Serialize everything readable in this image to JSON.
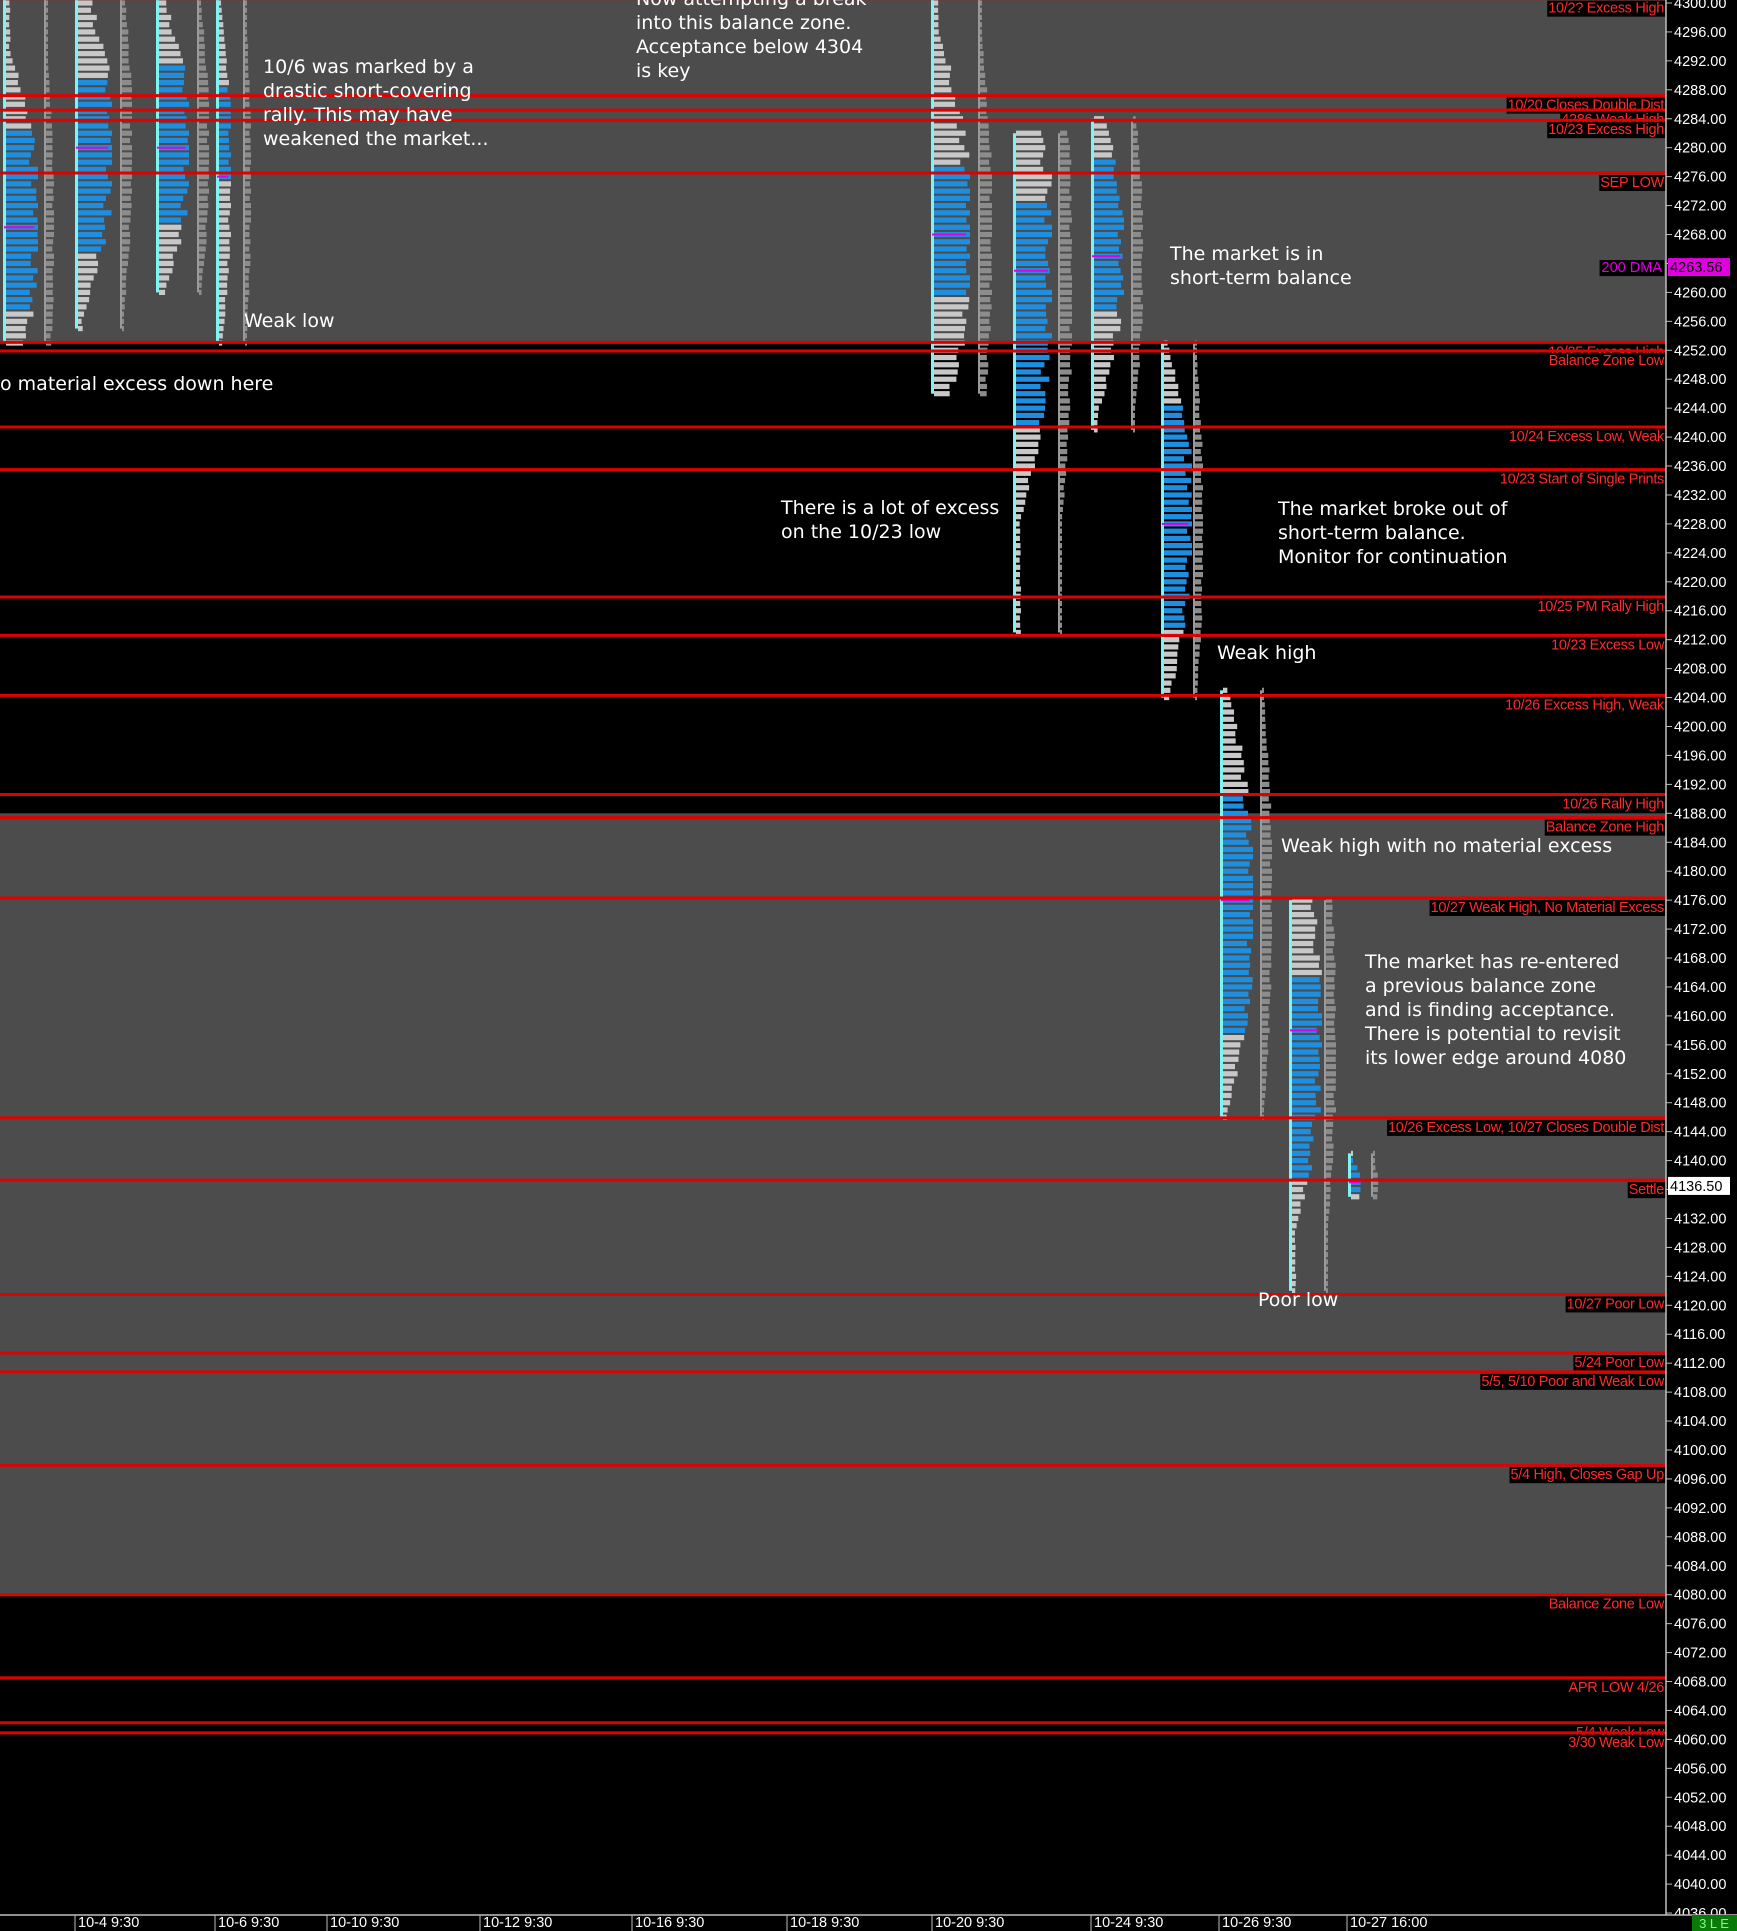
{
  "chart_data": {
    "type": "market_profile",
    "y_axis": {
      "min": 4035.5,
      "max": 4301.5,
      "tick_step": 4,
      "decimals": 2,
      "side": "right"
    },
    "x_axis_labels": [
      "10-4  9:30",
      "10-6  9:30",
      "10-10  9:30",
      "10-12  9:30",
      "10-16  9:30",
      "10-18  9:30",
      "10-20  9:30",
      "10-24  9:30",
      "10-26  9:30",
      "10-27  16:00"
    ],
    "corner_badge": "3 L E",
    "colors": {
      "background": "#000000",
      "zone_fill": "#4c4c4c",
      "level_line": "#e00000",
      "profile_blue": "#1e8fe0",
      "profile_gray": "#c8c8c8",
      "profile_cyan": "#7ff3f3",
      "poc": "#e000e0",
      "dma_tag": "#e000e0"
    },
    "balance_zones": [
      {
        "from": 4253,
        "to": 4301.5
      },
      {
        "from": 4080,
        "to": 4188
      }
    ],
    "levels": [
      {
        "price": 4300.6,
        "label": "10/2? Excess High"
      },
      {
        "price": 4287.2,
        "label": "10/20 Closes Double Dist"
      },
      {
        "price": 4285.2,
        "label": "4286 Weak High"
      },
      {
        "price": 4283.8,
        "label": "10/23 Excess High"
      },
      {
        "price": 4276.5,
        "label": "SEP LOW"
      },
      {
        "price": 4253.1,
        "label": "10/25 Excess High"
      },
      {
        "price": 4251.9,
        "label": "Balance Zone Low"
      },
      {
        "price": 4241.4,
        "label": "10/24 Excess Low, Weak"
      },
      {
        "price": 4235.5,
        "label": "10/23 Start of Single Prints"
      },
      {
        "price": 4217.9,
        "label": "10/25 PM Rally High"
      },
      {
        "price": 4212.6,
        "label": "10/23 Excess Low"
      },
      {
        "price": 4204.3,
        "label": "10/26 Excess High, Weak"
      },
      {
        "price": 4190.6,
        "label": "10/26 Rally High"
      },
      {
        "price": 4187.4,
        "label": "Balance Zone High"
      },
      {
        "price": 4176.3,
        "label": "10/27 Weak High, No Material Excess"
      },
      {
        "price": 4145.9,
        "label": "10/26 Excess Low, 10/27 Closes Double Dist"
      },
      {
        "price": 4137.3,
        "label": "Settle"
      },
      {
        "price": 4121.5,
        "label": "10/27 Poor Low"
      },
      {
        "price": 4113.4,
        "label": "5/24 Poor Low"
      },
      {
        "price": 4110.8,
        "label": "5/5, 5/10 Poor and Weak Low"
      },
      {
        "price": 4097.9,
        "label": "5/4 High, Closes Gap Up"
      },
      {
        "price": 4080.0,
        "label": "Balance Zone Low"
      },
      {
        "price": 4068.5,
        "label": "APR LOW 4/26"
      },
      {
        "price": 4062.3,
        "label": "5/4 Weak Low"
      },
      {
        "price": 4060.9,
        "label": "3/30 Weak Low"
      }
    ],
    "price_tags": [
      {
        "price": 4263.5,
        "label": "200 DMA",
        "value": "4263.56"
      },
      {
        "price": 4136.5,
        "label": "Settle",
        "value": "4136.50"
      }
    ],
    "profiles": [
      {
        "day": "10/3",
        "high": 4301.5,
        "low": 4253,
        "va_high": 4282,
        "va_low": 4258,
        "poc": 4269
      },
      {
        "day": "10/4",
        "high": 4301.5,
        "low": 4255,
        "va_high": 4289,
        "va_low": 4266,
        "poc": 4280
      },
      {
        "day": "10/5",
        "high": 4301.5,
        "low": 4260,
        "va_high": 4291,
        "va_low": 4270,
        "poc": 4280
      },
      {
        "day": "10/6",
        "high": 4301.5,
        "low": 4253,
        "va_high": 4288,
        "va_low": 4276,
        "poc": 4276
      },
      {
        "day": "10/20",
        "high": 4301.5,
        "low": 4246,
        "va_high": 4277,
        "va_low": 4260,
        "poc": 4268
      },
      {
        "day": "10/23",
        "high": 4282,
        "low": 4213,
        "va_high": 4272,
        "va_low": 4242,
        "poc": 4263
      },
      {
        "day": "10/24",
        "high": 4284,
        "low": 4241,
        "va_high": 4278,
        "va_low": 4258,
        "poc": 4265
      },
      {
        "day": "10/25",
        "high": 4253,
        "low": 4204,
        "va_high": 4244,
        "va_low": 4214,
        "poc": 4228
      },
      {
        "day": "10/26",
        "high": 4205,
        "low": 4146,
        "va_high": 4190,
        "va_low": 4158,
        "poc": 4176
      },
      {
        "day": "10/27",
        "high": 4176,
        "low": 4122,
        "va_high": 4165,
        "va_low": 4138,
        "poc": 4158
      },
      {
        "day": "10/30",
        "high": 4141,
        "low": 4135,
        "va_high": 4140,
        "va_low": 4136,
        "poc": 4137
      }
    ],
    "annotations": [
      {
        "lines": [
          "Now attempting a break",
          "into this balance zone.",
          "Acceptance below 4304",
          "is key"
        ]
      },
      {
        "lines": [
          "10/6 was marked by a",
          "drastic short-covering",
          "rally. This may have",
          "weakened the market..."
        ]
      },
      {
        "lines": [
          "Weak low"
        ]
      },
      {
        "lines": [
          "o material excess down here"
        ]
      },
      {
        "lines": [
          "The market is in",
          "short-term balance"
        ]
      },
      {
        "lines": [
          "There is a lot of excess",
          "on the 10/23 low"
        ]
      },
      {
        "lines": [
          "The market broke out of",
          "short-term balance.",
          "Monitor for continuation"
        ]
      },
      {
        "lines": [
          "Weak high"
        ]
      },
      {
        "lines": [
          "Weak high with no material excess"
        ]
      },
      {
        "lines": [
          "The market has re-entered",
          "a previous balance zone",
          "and is finding acceptance.",
          "There is potential to revisit",
          "its lower edge around 4080"
        ]
      },
      {
        "lines": [
          "Poor low"
        ]
      }
    ]
  }
}
